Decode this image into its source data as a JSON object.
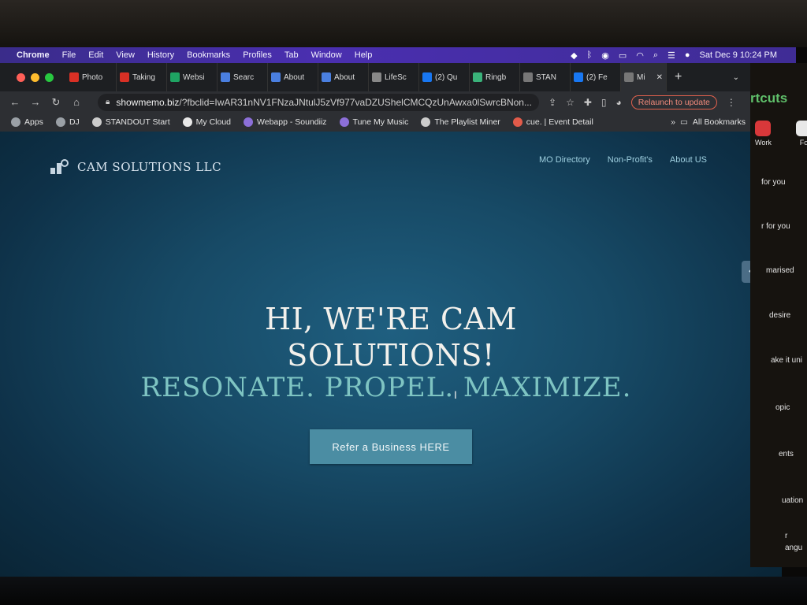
{
  "menubar": {
    "app": "Chrome",
    "items": [
      "File",
      "Edit",
      "View",
      "History",
      "Bookmarks",
      "Profiles",
      "Tab",
      "Window",
      "Help"
    ],
    "datetime": "Sat Dec 9  10:24 PM",
    "status_icons": [
      "dropbox-icon",
      "bluetooth-icon",
      "airplay-icon",
      "battery-icon",
      "wifi-icon",
      "search-icon",
      "control-center-icon",
      "siri-icon"
    ]
  },
  "tabs": [
    {
      "label": "Photo",
      "icon": "gmail-icon",
      "color": "#d93025"
    },
    {
      "label": "Taking",
      "icon": "gmail-icon",
      "color": "#d93025"
    },
    {
      "label": "Websi",
      "icon": "drive-icon",
      "color": "#1fa463"
    },
    {
      "label": "Searc",
      "icon": "docs-icon",
      "color": "#4a7fe0"
    },
    {
      "label": "About",
      "icon": "docs-icon",
      "color": "#4a7fe0"
    },
    {
      "label": "About",
      "icon": "docs-icon",
      "color": "#4a7fe0"
    },
    {
      "label": "LifeSc",
      "icon": "shield-icon",
      "color": "#888888"
    },
    {
      "label": "(2) Qu",
      "icon": "facebook-icon",
      "color": "#1877f2"
    },
    {
      "label": "Ringb",
      "icon": "check-icon",
      "color": "#3ab27a"
    },
    {
      "label": "STAN",
      "icon": "standout-icon",
      "color": "#777777"
    },
    {
      "label": "(2) Fe",
      "icon": "facebook-icon",
      "color": "#1877f2"
    },
    {
      "label": "Mi",
      "icon": "site-icon",
      "color": "#777777",
      "active": true
    }
  ],
  "toolbar": {
    "url_host": "showmemo.biz",
    "url_rest": "/?fbclid=IwAR31nNV1FNzaJNtulJ5zVf977vaDZUShelCMCQzUnAwxa0lSwrcBNon...",
    "relaunch_label": "Relaunch to update"
  },
  "bookmarks": {
    "items": [
      {
        "label": "Apps",
        "color": "#9aa0a6"
      },
      {
        "label": "DJ",
        "color": "#9aa0a6"
      },
      {
        "label": "STANDOUT Start",
        "color": "#cccccc"
      },
      {
        "label": "My Cloud",
        "color": "#e8e8e8"
      },
      {
        "label": "Webapp - Soundiiz",
        "color": "#8c6fd8"
      },
      {
        "label": "Tune My Music",
        "color": "#8c6fd8"
      },
      {
        "label": "The Playlist Miner",
        "color": "#cccccc"
      },
      {
        "label": "cue. | Event Detail",
        "color": "#e25b4a"
      }
    ],
    "more": "»",
    "all": "All Bookmarks"
  },
  "site": {
    "brand": "CAM SOLUTIONS LLC",
    "nav": [
      "MO Directory",
      "Non-Profit's",
      "About US"
    ],
    "heading_line1": "HI, WE'RE CAM",
    "heading_line2": "SOLUTIONS!",
    "tagline": "RESONATE. PROPEL. MAXIMIZE.",
    "cta": "Refer a Business HERE"
  },
  "sidepanel": {
    "title": "rtcuts",
    "apps": [
      "Work",
      "Fo"
    ],
    "lines": [
      "for you",
      "r for you",
      "marised",
      "desire",
      "ake it uni",
      "opic",
      "ents",
      "uation",
      "r",
      "angu"
    ]
  }
}
